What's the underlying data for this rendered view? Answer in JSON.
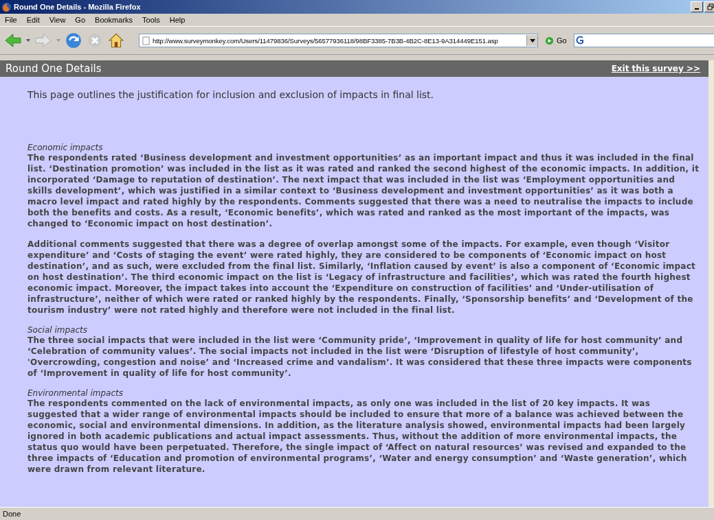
{
  "window": {
    "title": "Round One Details - Mozilla Firefox"
  },
  "menu": [
    "File",
    "Edit",
    "View",
    "Go",
    "Bookmarks",
    "Tools",
    "Help"
  ],
  "toolbar": {
    "url": "http://www.surveymonkey.com/Users/11479836/Surveys/56577936118/98BF3385-7B3B-4B2C-8E13-9A314449E151.asp",
    "go": "Go"
  },
  "page": {
    "title": "Round One Details",
    "exit_link": "Exit this survey >>",
    "intro": "This page outlines the justification for inclusion and exclusion of impacts in final list.",
    "sections": [
      {
        "heading": "Economic impacts",
        "paragraphs": [
          "The respondents rated ‘Business development and investment opportunities’ as an important impact and thus it was included in the final list. ‘Destination promotion’ was included in the list as it was rated and ranked the second highest of the economic impacts. In addition, it incorporated ‘Damage to reputation of destination’. The next impact that was included in the list was ‘Employment opportunities and skills development’, which was justified in a similar context to ‘Business development and investment opportunities’ as it was both a macro level impact and rated highly by the respondents. Comments suggested that there was a need to neutralise the impacts to include both the benefits and costs. As a result, ‘Economic benefits’, which was rated and ranked as the most important of the impacts, was changed to ‘Economic impact on host destination’.",
          "Additional comments suggested that there was a degree of overlap amongst some of the impacts. For example, even though ‘Visitor expenditure’ and ‘Costs of staging the event’ were rated highly, they are considered to be components of ‘Economic impact on host destination’, and as such, were excluded from the final list. Similarly, ‘Inflation caused by event’ is also a component of ‘Economic impact on host destination’. The third economic impact on the list is ‘Legacy of infrastructure and facilities’, which was rated the fourth highest economic impact. Moreover, the impact takes into account the ‘Expenditure on construction of facilities’ and ‘Under-utilisation of infrastructure’, neither of which were rated or ranked highly by the respondents. Finally, ‘Sponsorship benefits’ and ‘Development of the tourism industry’ were not rated highly and therefore were not included in the final list."
        ]
      },
      {
        "heading": "Social impacts",
        "paragraphs": [
          "The three social impacts that were included in the list were ‘Community pride’, ‘Improvement in quality of life for host community’ and ‘Celebration of community values’. The social impacts not included in the list were ‘Disruption of lifestyle of host community’, 'Overcrowding, congestion and noise’ and ‘Increased crime and vandalism’. It was considered that these three impacts were components of ‘Improvement in quality of life for host community’."
        ]
      },
      {
        "heading": "Environmental impacts",
        "paragraphs": [
          "The respondents commented on the lack of environmental impacts, as only one was included in the list of 20 key impacts. It was suggested that a wider range of environmental impacts should be included to ensure that more of a balance was achieved between the economic, social and environmental dimensions. In addition, as the literature analysis showed, environmental impacts had been largely ignored in both academic publications and actual impact assessments. Thus, without the addition of more environmental impacts, the status quo would have been perpetuated. Therefore, the single impact of ‘Affect on natural resources’ was revised and expanded to the three impacts of ‘Education and promotion of environmental programs’, ‘Water and energy consumption’ and ‘Waste generation’, which were drawn from relevant literature."
        ]
      }
    ]
  },
  "status_bar": {
    "text": "Done"
  }
}
